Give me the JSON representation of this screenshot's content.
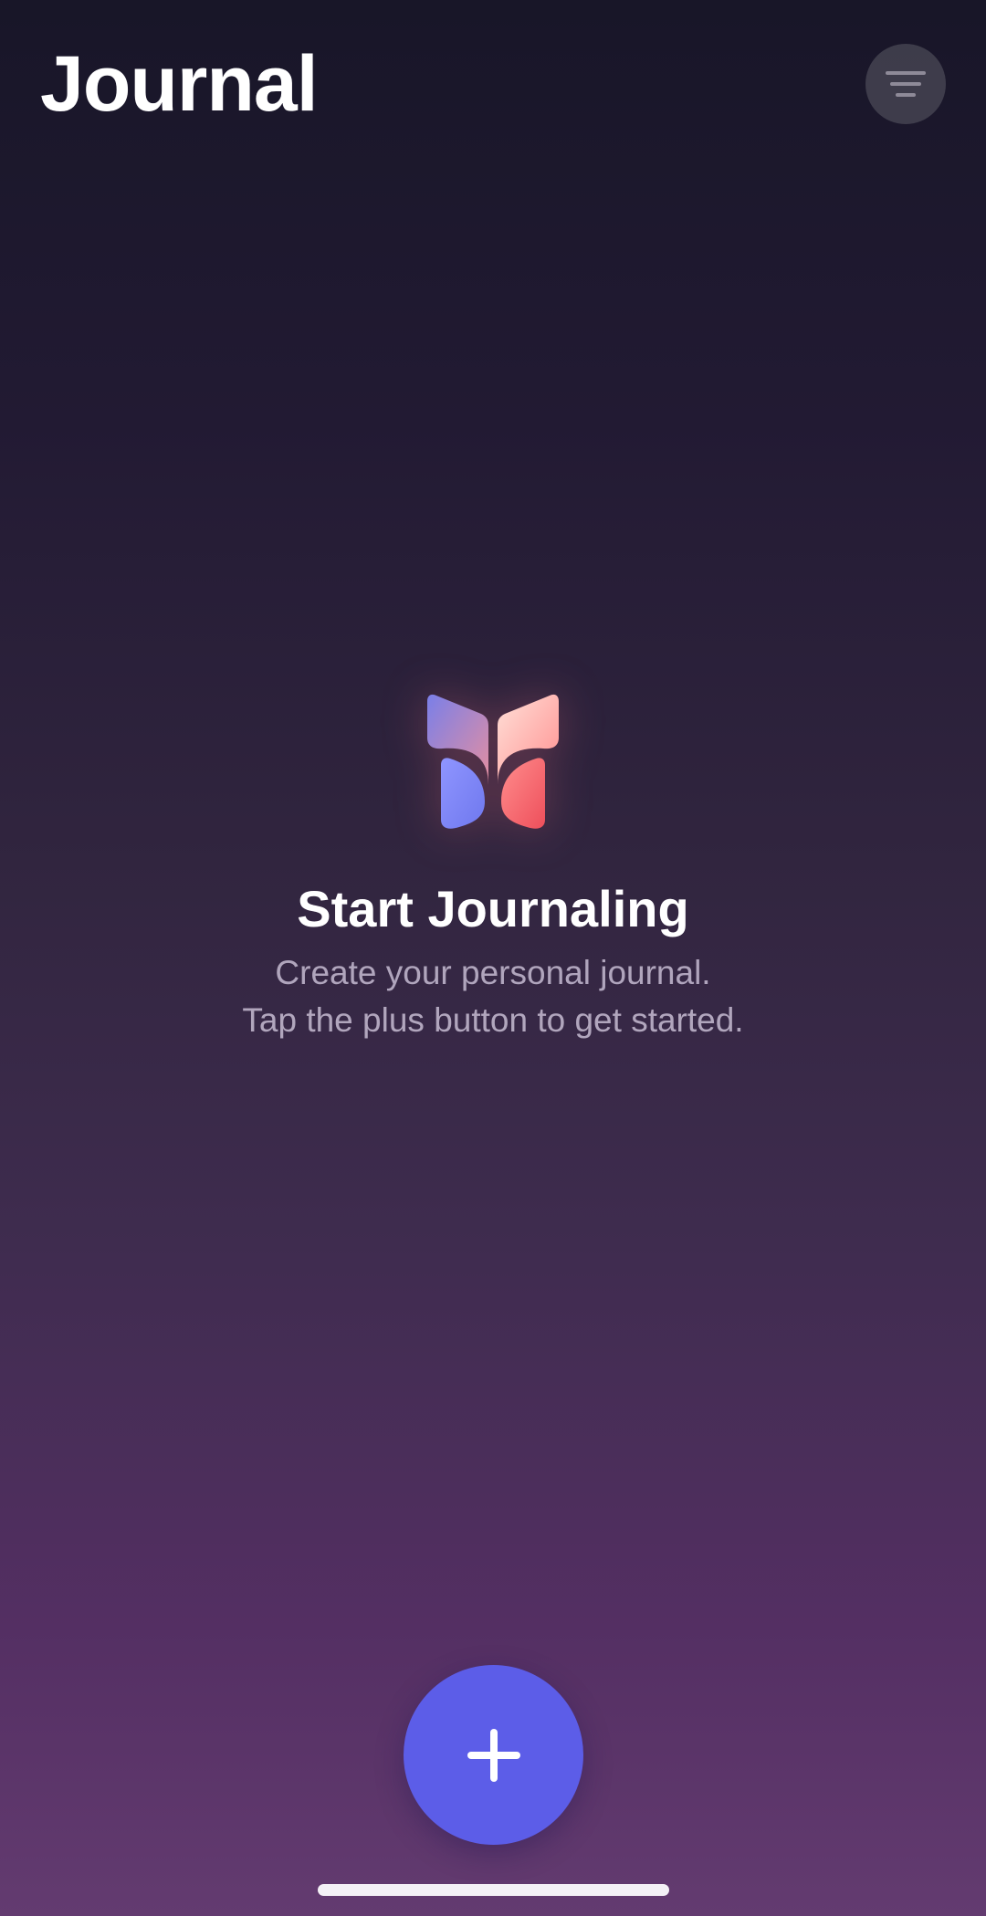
{
  "header": {
    "title": "Journal",
    "menu_icon": "filter-lines-icon"
  },
  "empty_state": {
    "logo_icon": "journal-butterfly-icon",
    "title": "Start Journaling",
    "line1": "Create your personal journal.",
    "line2": "Tap the plus button to get started."
  },
  "fab": {
    "icon": "plus-icon",
    "color": "#5c5de8"
  },
  "colors": {
    "background_top": "#181628",
    "background_bottom": "#633b70",
    "logo_blue": "#7f86f4",
    "logo_red": "#ff6b6b"
  }
}
